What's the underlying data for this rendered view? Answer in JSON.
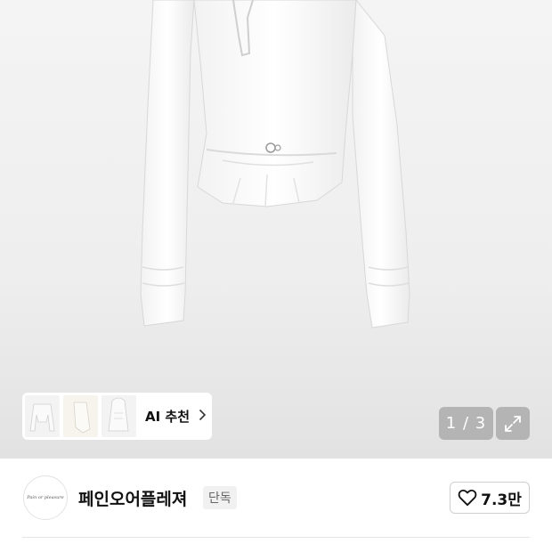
{
  "gallery": {
    "ai_label": "AI 추천",
    "pager_text": "1 / 3",
    "thumbnails": [
      "thumb-front",
      "thumb-side",
      "thumb-hood"
    ],
    "icons": {
      "chevron": "chevron-right-icon",
      "expand": "expand-icon"
    }
  },
  "brand": {
    "logo_text": "Pain or pleasure",
    "name": "페인오어플레져",
    "badge": "단독"
  },
  "like": {
    "count": "7.3만",
    "icon": "heart-outline-icon"
  },
  "colors": {
    "background": "#ffffff",
    "hero_background": "#eeeeee",
    "overlay": "#8c8c8c"
  }
}
